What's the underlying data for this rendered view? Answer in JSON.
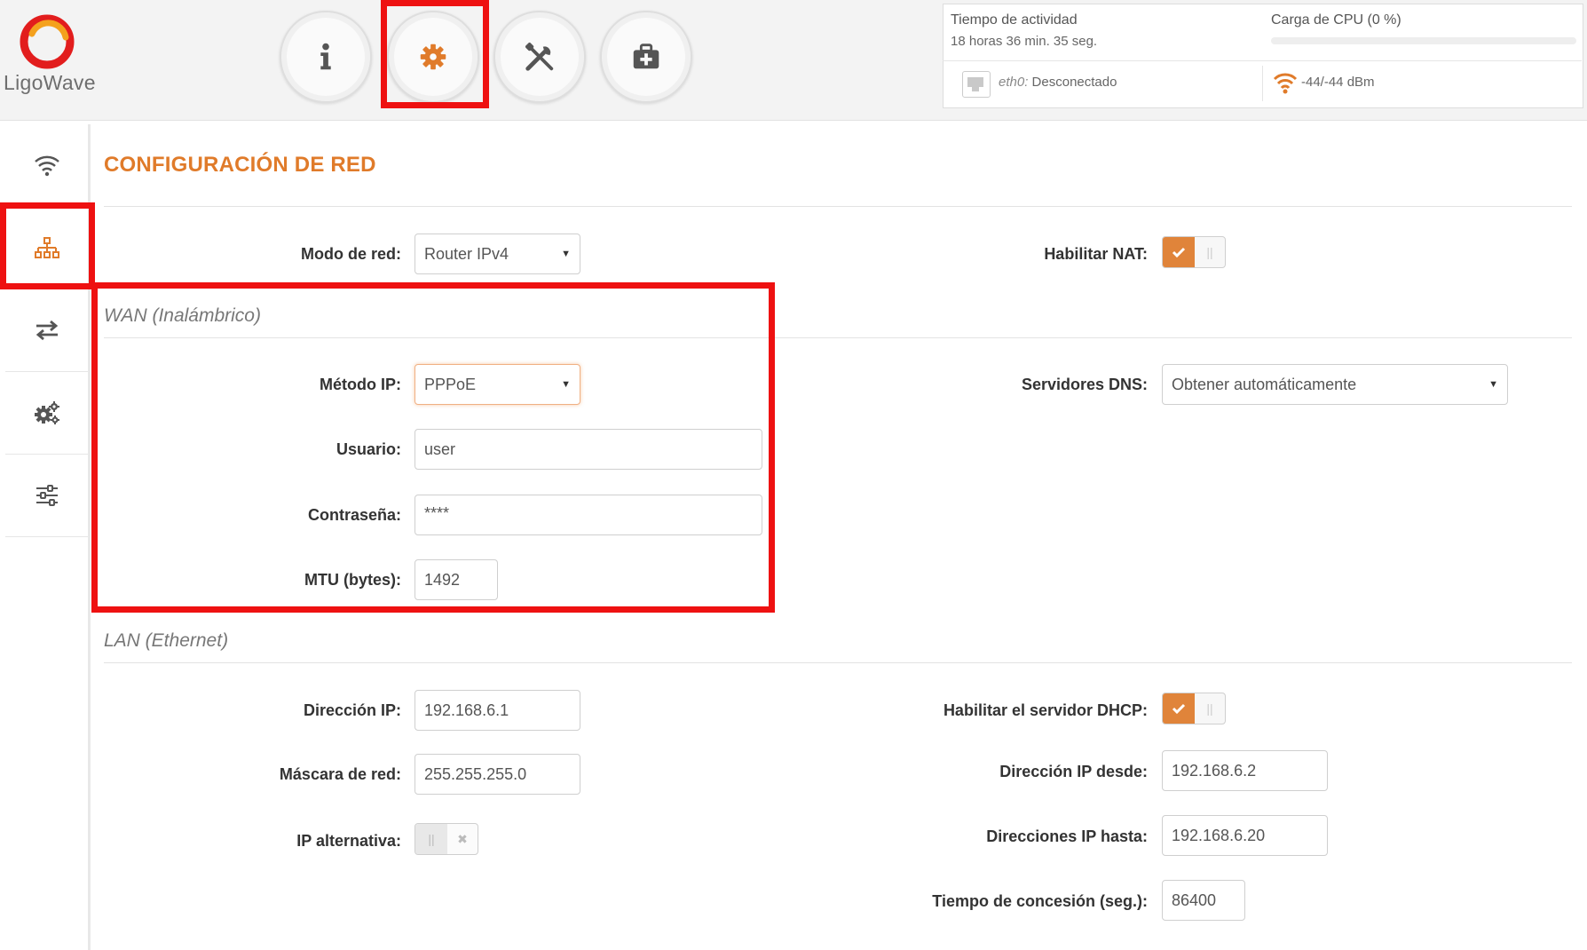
{
  "brand": {
    "name": "LigoWave"
  },
  "toolbar": {
    "buttons": [
      {
        "id": "info",
        "icon": "info-icon"
      },
      {
        "id": "settings",
        "icon": "gear-icon",
        "active": true
      },
      {
        "id": "tools",
        "icon": "tools-icon"
      },
      {
        "id": "toolbox",
        "icon": "toolbox-icon"
      }
    ]
  },
  "status": {
    "uptime_label": "Tiempo de actividad",
    "uptime_value": "18 horas 36 min. 35 seg.",
    "cpu_label": "Carga de CPU (0 %)",
    "cpu_percent": 0,
    "eth_name": "eth0:",
    "eth_status": "Desconectado",
    "signal": "-44/-44 dBm"
  },
  "sidebar": {
    "items": [
      {
        "id": "wireless",
        "icon": "wifi-icon"
      },
      {
        "id": "network",
        "icon": "network-icon",
        "active": true
      },
      {
        "id": "routing",
        "icon": "transfer-icon"
      },
      {
        "id": "services",
        "icon": "gears-icon"
      },
      {
        "id": "system",
        "icon": "sliders-icon"
      }
    ]
  },
  "page": {
    "title": "CONFIGURACIÓN DE RED"
  },
  "network_mode": {
    "label": "Modo de red:",
    "value": "Router IPv4"
  },
  "nat": {
    "label": "Habilitar NAT:",
    "enabled": true
  },
  "wan": {
    "section": "WAN (Inalámbrico)",
    "ip_method_label": "Método IP:",
    "ip_method_value": "PPPoE",
    "user_label": "Usuario:",
    "user_value": "user",
    "password_label": "Contraseña:",
    "password_value": "****",
    "mtu_label": "MTU (bytes):",
    "mtu_value": "1492",
    "dns_label": "Servidores DNS:",
    "dns_value": "Obtener automáticamente"
  },
  "lan": {
    "section": "LAN (Ethernet)",
    "ip_label": "Dirección IP:",
    "ip_value": "192.168.6.1",
    "mask_label": "Máscara de red:",
    "mask_value": "255.255.255.0",
    "alt_ip_label": "IP alternativa:",
    "alt_ip_enabled": false,
    "dhcp_label": "Habilitar el servidor DHCP:",
    "dhcp_enabled": true,
    "ip_from_label": "Dirección IP desde:",
    "ip_from_value": "192.168.6.2",
    "ip_to_label": "Direcciones IP hasta:",
    "ip_to_value": "192.168.6.20",
    "lease_label": "Tiempo de concesión (seg.):",
    "lease_value": "86400"
  },
  "colors": {
    "accent": "#e07b2a",
    "highlight": "#ee1111"
  }
}
